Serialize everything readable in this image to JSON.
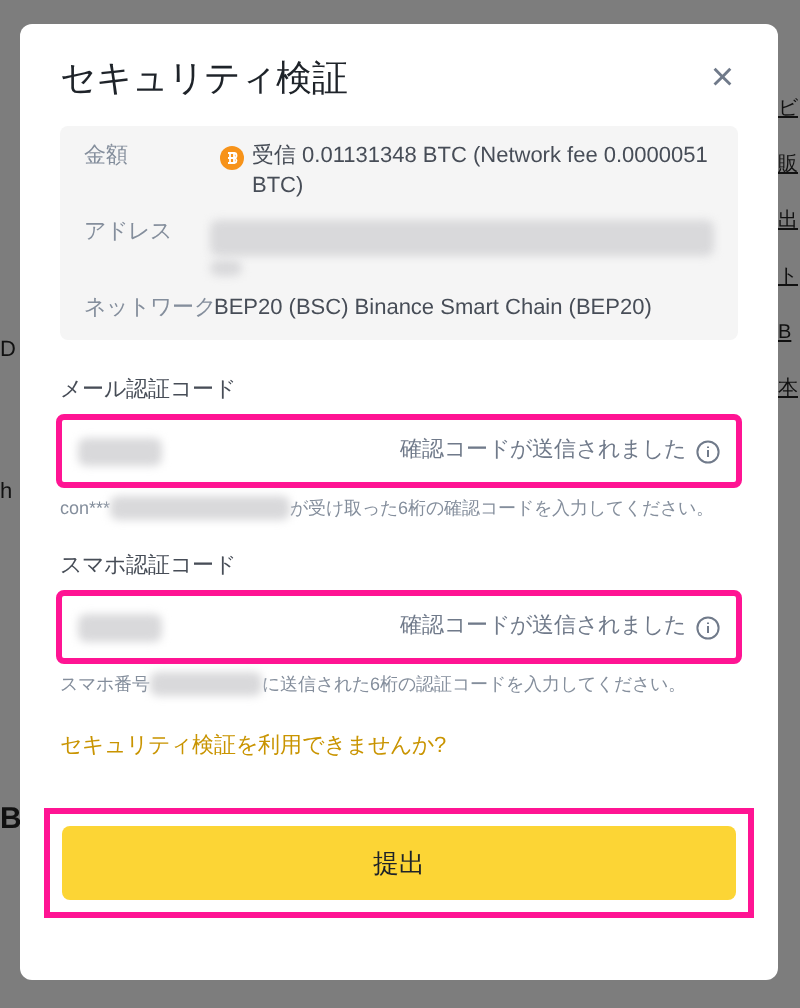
{
  "background_fragments": {
    "left": [
      {
        "text": "D",
        "kind": "small"
      },
      {
        "text": "h",
        "kind": "small"
      },
      {
        "text": "B",
        "kind": "big"
      }
    ],
    "right": [
      "ビ",
      "販",
      "出",
      "ト",
      "B",
      "本"
    ]
  },
  "dialog": {
    "title": "セキュリティ検証",
    "close": "×",
    "details": [
      {
        "label": "金額",
        "kind": "amount",
        "value": "受信 0.01131348 BTC (Network fee 0.0000051 BTC)"
      },
      {
        "label": "アドレス",
        "kind": "hidden"
      },
      {
        "label": "ネットワーク",
        "kind": "text",
        "value": "BEP20 (BSC) Binance Smart Chain (BEP20)"
      }
    ],
    "code_fields": [
      {
        "label": "メール認証コード",
        "status": "確認コードが送信されました",
        "hint_prefix": "con***",
        "hint_suffix": "が受け取った6桁の確認コードを入力してください。",
        "highlighted": true
      },
      {
        "label": "スマホ認証コード",
        "status": "確認コードが送信されました",
        "hint_prefix": "スマホ番号",
        "hint_suffix": "に送信された6桁の認証コードを入力してください。",
        "highlighted": true
      }
    ],
    "help_link": "セキュリティ検証を利用できませんか?",
    "submit": {
      "label": "提出",
      "highlighted": true
    }
  }
}
